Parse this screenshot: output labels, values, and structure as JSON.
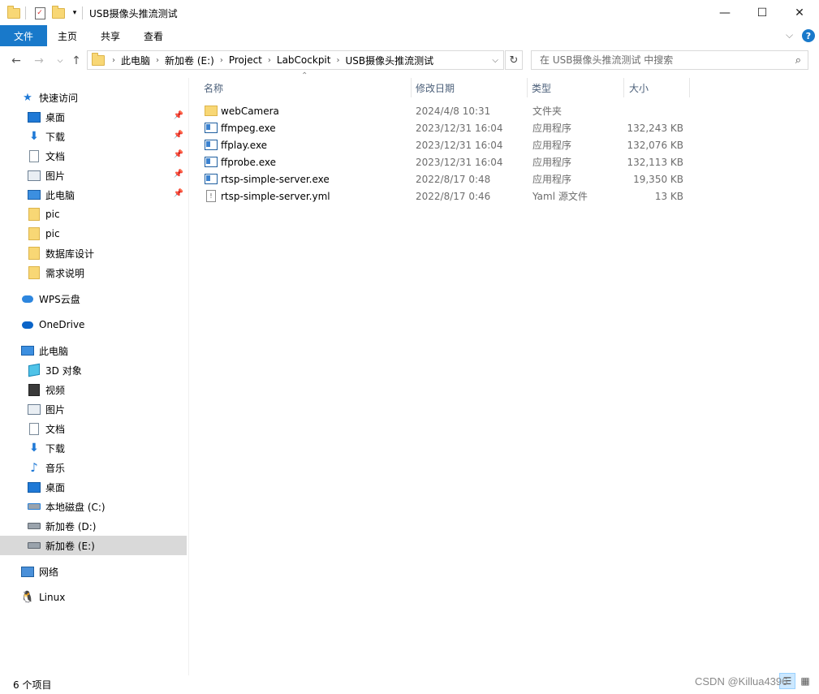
{
  "window": {
    "title": "USB摄像头推流测试",
    "controls": {
      "minimize": "—",
      "maximize": "☐",
      "close": "✕"
    }
  },
  "ribbon": {
    "tabs": [
      "文件",
      "主页",
      "共享",
      "查看"
    ],
    "help": "?"
  },
  "address": {
    "segments": [
      "此电脑",
      "新加卷 (E:)",
      "Project",
      "LabCockpit",
      "USB摄像头推流测试"
    ],
    "search_placeholder": "在 USB摄像头推流测试 中搜索"
  },
  "sidebar": {
    "quick_access": {
      "label": "快速访问",
      "items": [
        {
          "label": "桌面",
          "icon": "desktop-icon",
          "pinned": true
        },
        {
          "label": "下载",
          "icon": "download-icon",
          "pinned": true
        },
        {
          "label": "文档",
          "icon": "document-icon",
          "pinned": true
        },
        {
          "label": "图片",
          "icon": "picture-icon",
          "pinned": true
        },
        {
          "label": "此电脑",
          "icon": "computer-icon",
          "pinned": true
        },
        {
          "label": "pic",
          "icon": "folder-icon",
          "pinned": false
        },
        {
          "label": "pic",
          "icon": "folder-icon",
          "pinned": false
        },
        {
          "label": "数据库设计",
          "icon": "folder-icon",
          "pinned": false
        },
        {
          "label": "需求说明",
          "icon": "folder-icon",
          "pinned": false
        }
      ]
    },
    "wps": "WPS云盘",
    "onedrive": "OneDrive",
    "this_pc": {
      "label": "此电脑",
      "items": [
        {
          "label": "3D 对象",
          "icon": "3d-objects-icon"
        },
        {
          "label": "视频",
          "icon": "video-icon"
        },
        {
          "label": "图片",
          "icon": "picture-icon"
        },
        {
          "label": "文档",
          "icon": "document-icon"
        },
        {
          "label": "下载",
          "icon": "download-icon"
        },
        {
          "label": "音乐",
          "icon": "music-icon"
        },
        {
          "label": "桌面",
          "icon": "desktop-icon"
        },
        {
          "label": "本地磁盘 (C:)",
          "icon": "drive-icon"
        },
        {
          "label": "新加卷 (D:)",
          "icon": "drive-icon"
        },
        {
          "label": "新加卷 (E:)",
          "icon": "drive-icon",
          "selected": true
        }
      ]
    },
    "network": "网络",
    "linux": "Linux"
  },
  "columns": {
    "name": "名称",
    "date": "修改日期",
    "type": "类型",
    "size": "大小"
  },
  "files": [
    {
      "name": "webCamera",
      "date": "2024/4/8 10:31",
      "type": "文件夹",
      "size": "",
      "icon": "folder-icon"
    },
    {
      "name": "ffmpeg.exe",
      "date": "2023/12/31 16:04",
      "type": "应用程序",
      "size": "132,243 KB",
      "icon": "exe-icon"
    },
    {
      "name": "ffplay.exe",
      "date": "2023/12/31 16:04",
      "type": "应用程序",
      "size": "132,076 KB",
      "icon": "exe-icon"
    },
    {
      "name": "ffprobe.exe",
      "date": "2023/12/31 16:04",
      "type": "应用程序",
      "size": "132,113 KB",
      "icon": "exe-icon"
    },
    {
      "name": "rtsp-simple-server.exe",
      "date": "2022/8/17 0:48",
      "type": "应用程序",
      "size": "19,350 KB",
      "icon": "exe-icon"
    },
    {
      "name": "rtsp-simple-server.yml",
      "date": "2022/8/17 0:46",
      "type": "Yaml 源文件",
      "size": "13 KB",
      "icon": "yml-icon"
    }
  ],
  "status": {
    "count": "6 个项目"
  },
  "watermark": "CSDN @Killua4396"
}
